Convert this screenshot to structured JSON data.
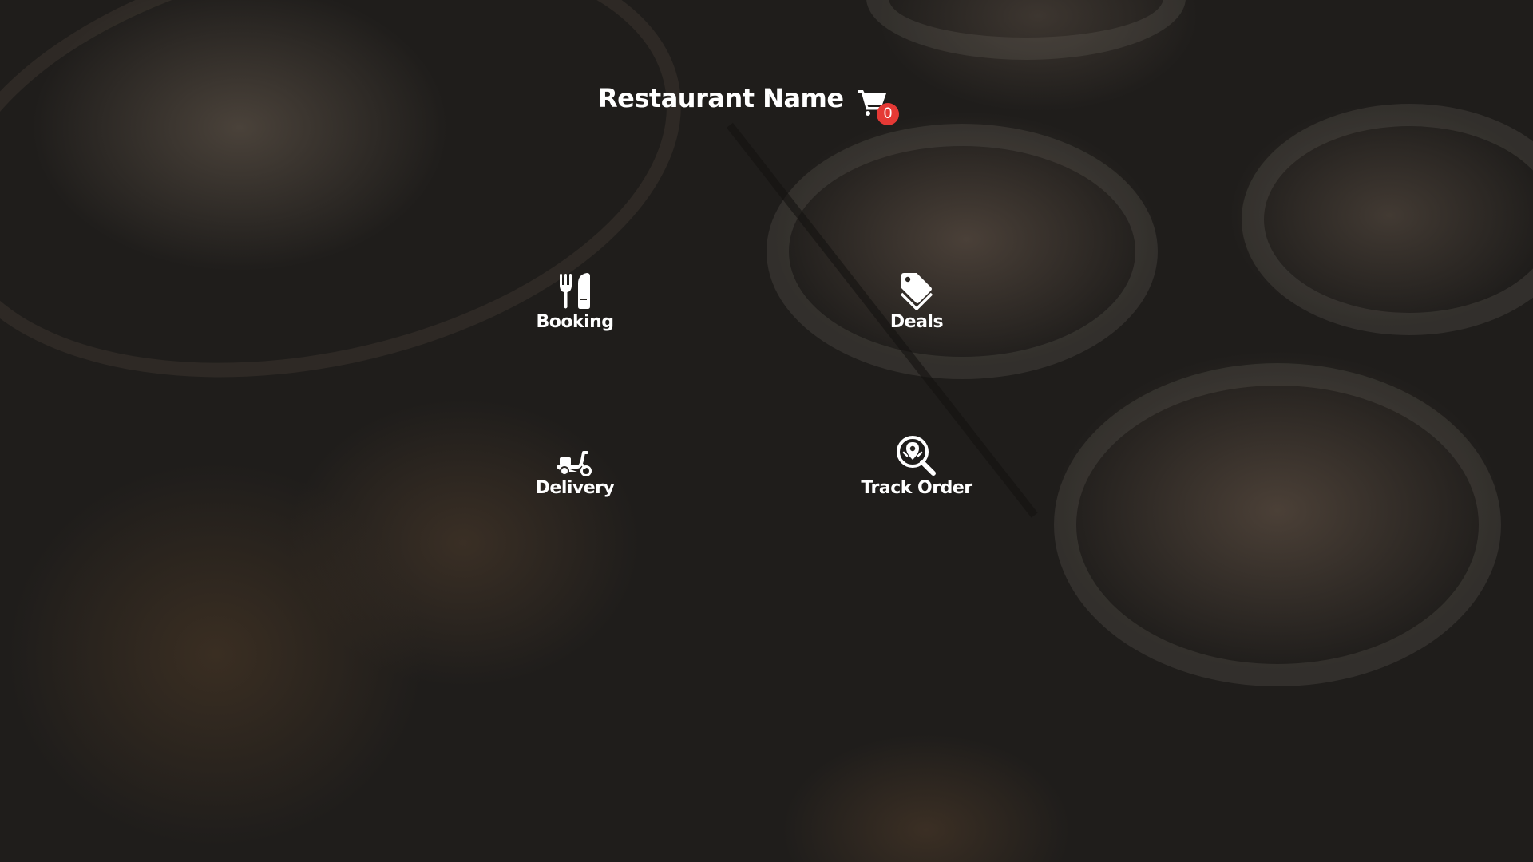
{
  "header": {
    "title": "Restaurant Name",
    "cart_icon": "shopping-cart-icon",
    "cart_count": "0"
  },
  "menu": {
    "items": [
      {
        "label": "Booking",
        "icon": "fork-knife-icon"
      },
      {
        "label": "Deals",
        "icon": "price-tag-icon"
      },
      {
        "label": "Delivery",
        "icon": "scooter-icon"
      },
      {
        "label": "Track Order",
        "icon": "location-search-icon"
      }
    ]
  },
  "colors": {
    "text": "#ffffff",
    "badge": "#e53935",
    "background_overlay": "#1f1d1b"
  }
}
